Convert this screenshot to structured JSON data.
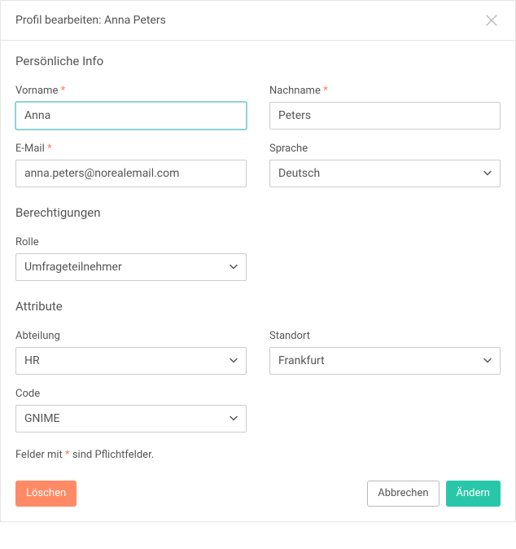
{
  "header": {
    "title": "Profil bearbeiten: Anna Peters"
  },
  "sections": {
    "personal": "Persönliche Info",
    "permissions": "Berechtigungen",
    "attributes": "Attribute"
  },
  "fields": {
    "firstName": {
      "label": "Vorname",
      "value": "Anna",
      "required": true
    },
    "lastName": {
      "label": "Nachname",
      "value": "Peters",
      "required": true
    },
    "email": {
      "label": "E-Mail",
      "value": "anna.peters@norealemail.com",
      "required": true
    },
    "language": {
      "label": "Sprache",
      "value": "Deutsch"
    },
    "role": {
      "label": "Rolle",
      "value": "Umfrageteilnehmer"
    },
    "department": {
      "label": "Abteilung",
      "value": "HR"
    },
    "location": {
      "label": "Standort",
      "value": "Frankfurt"
    },
    "code": {
      "label": "Code",
      "value": "GNIME"
    }
  },
  "hint": {
    "prefix": "Felder mit ",
    "asterisk": "*",
    "suffix": " sind Pflichtfelder."
  },
  "buttons": {
    "delete": "Löschen",
    "cancel": "Abbrechen",
    "save": "Ändern"
  },
  "glyphs": {
    "required": "*"
  }
}
